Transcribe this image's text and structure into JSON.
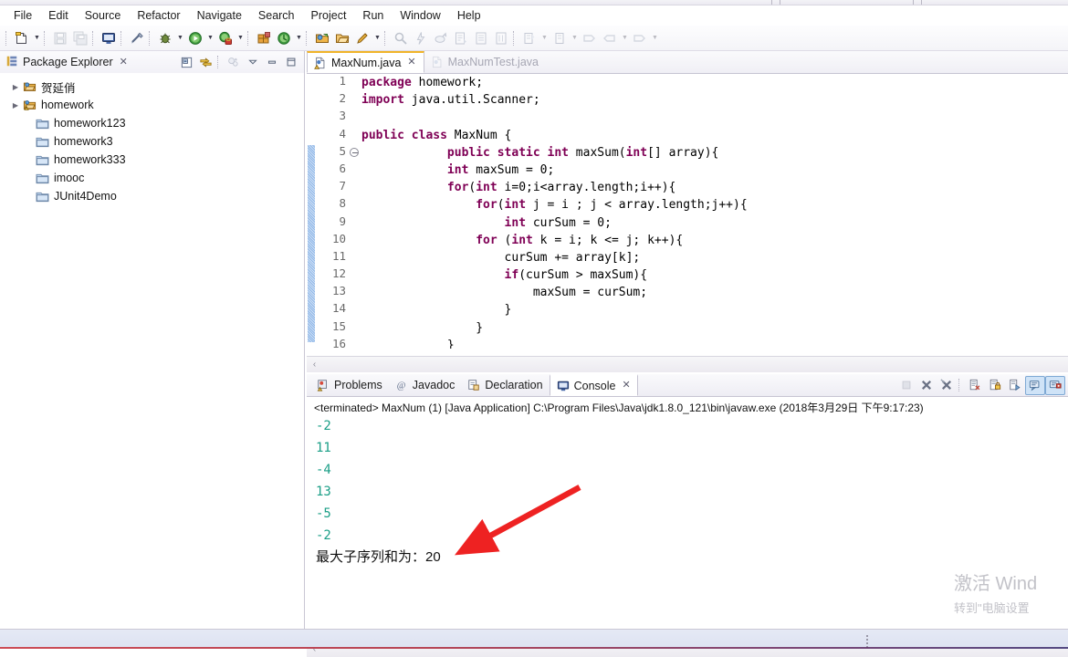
{
  "menubar": {
    "items": [
      {
        "label": "File"
      },
      {
        "label": "Edit"
      },
      {
        "label": "Source"
      },
      {
        "label": "Refactor"
      },
      {
        "label": "Navigate"
      },
      {
        "label": "Search"
      },
      {
        "label": "Project"
      },
      {
        "label": "Run"
      },
      {
        "label": "Window"
      },
      {
        "label": "Help"
      }
    ]
  },
  "toolbar": {
    "buttons": [
      {
        "name": "new-wizard-icon",
        "enabled": true
      },
      {
        "name": "new-wizard-dropdown-icon",
        "enabled": true
      },
      {
        "name": "save-icon",
        "enabled": false
      },
      {
        "name": "save-all-icon",
        "enabled": false
      },
      {
        "name": "new-java-console-icon",
        "enabled": true
      },
      {
        "name": "toggle-mark-occurrences-icon",
        "enabled": true
      },
      {
        "name": "debug-icon",
        "enabled": true
      },
      {
        "name": "debug-dropdown-icon",
        "enabled": true
      },
      {
        "name": "run-icon",
        "enabled": true
      },
      {
        "name": "run-dropdown-icon",
        "enabled": true
      },
      {
        "name": "coverage-icon",
        "enabled": true
      },
      {
        "name": "coverage-dropdown-icon",
        "enabled": true
      },
      {
        "name": "new-java-package-icon",
        "enabled": true
      },
      {
        "name": "external-tools-icon",
        "enabled": true
      },
      {
        "name": "external-tools-dropdown-icon",
        "enabled": true
      },
      {
        "name": "open-type-icon",
        "enabled": true
      },
      {
        "name": "open-task-icon",
        "enabled": true
      },
      {
        "name": "new-annotation-icon",
        "enabled": true
      },
      {
        "name": "annotation-dropdown-icon",
        "enabled": true
      },
      {
        "name": "search-icon",
        "enabled": false
      },
      {
        "name": "skip-breakpoints-icon",
        "enabled": false
      },
      {
        "name": "link-icon",
        "enabled": false
      },
      {
        "name": "next-annotation-icon",
        "enabled": false
      },
      {
        "name": "previous-annotation-icon",
        "enabled": false
      },
      {
        "name": "last-edit-location-icon",
        "enabled": false
      },
      {
        "name": "back-icon",
        "enabled": false
      },
      {
        "name": "back-dropdown-icon",
        "enabled": false
      },
      {
        "name": "forward-icon",
        "enabled": false
      },
      {
        "name": "forward-dropdown-icon",
        "enabled": false
      },
      {
        "name": "toggle-breadcrumb-icon",
        "enabled": false
      },
      {
        "name": "pin-editor-icon",
        "enabled": false
      },
      {
        "name": "forward-nav-icon",
        "enabled": false
      },
      {
        "name": "forward-nav-dropdown-icon",
        "enabled": false
      }
    ]
  },
  "package_explorer": {
    "title": "Package Explorer",
    "close_glyph": "✕",
    "toolbar": [
      {
        "name": "collapse-all-icon"
      },
      {
        "name": "link-with-editor-icon"
      },
      {
        "name": "view-filter-icon"
      },
      {
        "name": "view-menu-icon"
      },
      {
        "name": "minimize-view-icon"
      },
      {
        "name": "maximize-view-icon"
      }
    ],
    "tree": [
      {
        "label": "贺延俏",
        "icon": "java-project-icon",
        "expandable": true,
        "indent": 0
      },
      {
        "label": "homework",
        "icon": "java-project-warning-icon",
        "expandable": true,
        "indent": 0
      },
      {
        "label": "homework123",
        "icon": "folder-icon",
        "expandable": false,
        "indent": 1
      },
      {
        "label": "homework3",
        "icon": "folder-icon",
        "expandable": false,
        "indent": 1
      },
      {
        "label": "homework333",
        "icon": "folder-icon",
        "expandable": false,
        "indent": 1
      },
      {
        "label": "imooc",
        "icon": "folder-icon",
        "expandable": false,
        "indent": 1
      },
      {
        "label": "JUnit4Demo",
        "icon": "folder-icon",
        "expandable": false,
        "indent": 1
      }
    ]
  },
  "editor": {
    "tabs": [
      {
        "label": "MaxNum.java",
        "active": true,
        "icon": "java-file-warning-icon",
        "close_glyph": "✕"
      },
      {
        "label": "MaxNumTest.java",
        "active": false,
        "icon": "java-file-icon",
        "close_glyph": ""
      }
    ],
    "lines": [
      {
        "num": "1",
        "fold": false,
        "tokens": [
          {
            "t": "package",
            "c": "kw"
          },
          {
            "t": " homework;",
            "c": "pl"
          }
        ]
      },
      {
        "num": "2",
        "fold": false,
        "tokens": [
          {
            "t": "import",
            "c": "kw"
          },
          {
            "t": " java.util.Scanner;",
            "c": "pl"
          }
        ]
      },
      {
        "num": "3",
        "fold": false,
        "tokens": []
      },
      {
        "num": "4",
        "fold": false,
        "tokens": [
          {
            "t": "public class",
            "c": "kw"
          },
          {
            "t": " MaxNum {",
            "c": "pl"
          }
        ]
      },
      {
        "num": "5",
        "fold": true,
        "tokens": [
          {
            "t": "            ",
            "c": "pl"
          },
          {
            "t": "public static int",
            "c": "kw"
          },
          {
            "t": " maxSum(",
            "c": "pl"
          },
          {
            "t": "int",
            "c": "kw"
          },
          {
            "t": "[] array){",
            "c": "pl"
          }
        ]
      },
      {
        "num": "6",
        "fold": false,
        "tokens": [
          {
            "t": "            ",
            "c": "pl"
          },
          {
            "t": "int",
            "c": "kw"
          },
          {
            "t": " maxSum = 0;",
            "c": "pl"
          }
        ]
      },
      {
        "num": "7",
        "fold": false,
        "tokens": [
          {
            "t": "            ",
            "c": "pl"
          },
          {
            "t": "for",
            "c": "kw"
          },
          {
            "t": "(",
            "c": "pl"
          },
          {
            "t": "int",
            "c": "kw"
          },
          {
            "t": " i=0;i<array.length;i++){",
            "c": "pl"
          }
        ]
      },
      {
        "num": "8",
        "fold": false,
        "tokens": [
          {
            "t": "                ",
            "c": "pl"
          },
          {
            "t": "for",
            "c": "kw"
          },
          {
            "t": "(",
            "c": "pl"
          },
          {
            "t": "int",
            "c": "kw"
          },
          {
            "t": " j = i ; j < array.length;j++){",
            "c": "pl"
          }
        ]
      },
      {
        "num": "9",
        "fold": false,
        "tokens": [
          {
            "t": "                    ",
            "c": "pl"
          },
          {
            "t": "int",
            "c": "kw"
          },
          {
            "t": " curSum = 0;",
            "c": "pl"
          }
        ]
      },
      {
        "num": "10",
        "fold": false,
        "tokens": [
          {
            "t": "                ",
            "c": "pl"
          },
          {
            "t": "for",
            "c": "kw"
          },
          {
            "t": " (",
            "c": "pl"
          },
          {
            "t": "int",
            "c": "kw"
          },
          {
            "t": " k = i; k <= j; k++){",
            "c": "pl"
          }
        ]
      },
      {
        "num": "11",
        "fold": false,
        "tokens": [
          {
            "t": "                    curSum += array[k];",
            "c": "pl"
          }
        ]
      },
      {
        "num": "12",
        "fold": false,
        "tokens": [
          {
            "t": "                    ",
            "c": "pl"
          },
          {
            "t": "if",
            "c": "kw"
          },
          {
            "t": "(curSum > maxSum){",
            "c": "pl"
          }
        ]
      },
      {
        "num": "13",
        "fold": false,
        "tokens": [
          {
            "t": "                        maxSum = curSum;",
            "c": "pl"
          }
        ]
      },
      {
        "num": "14",
        "fold": false,
        "tokens": [
          {
            "t": "                    }",
            "c": "pl"
          }
        ]
      },
      {
        "num": "15",
        "fold": false,
        "tokens": [
          {
            "t": "                }",
            "c": "pl"
          }
        ]
      },
      {
        "num": "16",
        "fold": false,
        "tokens": [
          {
            "t": "            }",
            "c": "pl"
          }
        ]
      }
    ]
  },
  "console": {
    "tabs": [
      {
        "label": "Problems",
        "icon": "problems-icon",
        "active": false
      },
      {
        "label": "Javadoc",
        "icon": "javadoc-icon",
        "active": false
      },
      {
        "label": "Declaration",
        "icon": "declaration-icon",
        "active": false
      },
      {
        "label": "Console",
        "icon": "console-icon",
        "active": true,
        "close_glyph": "✕"
      }
    ],
    "toolbar": [
      {
        "name": "terminate-icon",
        "enabled": false
      },
      {
        "name": "remove-launch-icon",
        "enabled": true
      },
      {
        "name": "remove-all-terminated-icon",
        "enabled": true
      },
      {
        "name": "clear-console-icon",
        "enabled": true
      },
      {
        "name": "scroll-lock-icon",
        "enabled": true
      },
      {
        "name": "pin-console-icon",
        "enabled": true
      },
      {
        "name": "display-selected-console-icon",
        "enabled": true,
        "toggled": true
      },
      {
        "name": "open-console-icon",
        "enabled": true,
        "toggled": true
      }
    ],
    "terminated_line": "<terminated> MaxNum (1) [Java Application] C:\\Program Files\\Java\\jdk1.8.0_121\\bin\\javaw.exe (2018年3月29日 下午9:17:23)",
    "output": [
      {
        "text": "-2",
        "kind": "stdout"
      },
      {
        "text": "11",
        "kind": "stdout"
      },
      {
        "text": "-4",
        "kind": "stdout"
      },
      {
        "text": "13",
        "kind": "stdout"
      },
      {
        "text": "-5",
        "kind": "stdout"
      },
      {
        "text": "-2",
        "kind": "stdout"
      },
      {
        "text": "最大子序列和为：20",
        "kind": "result"
      }
    ]
  },
  "annotation": {
    "name": "red-arrow-annotation",
    "color": "#ee2222"
  },
  "watermark": {
    "line1": "激活 Wind",
    "line2": "转到\"电脑设置"
  },
  "scroll": {
    "left_arrow_glyph": "‹"
  },
  "colors": {
    "keyword": "#7f0055",
    "stdout": "#1a9e86",
    "accent_tab": "#f0b429",
    "arrow": "#ee2222"
  }
}
